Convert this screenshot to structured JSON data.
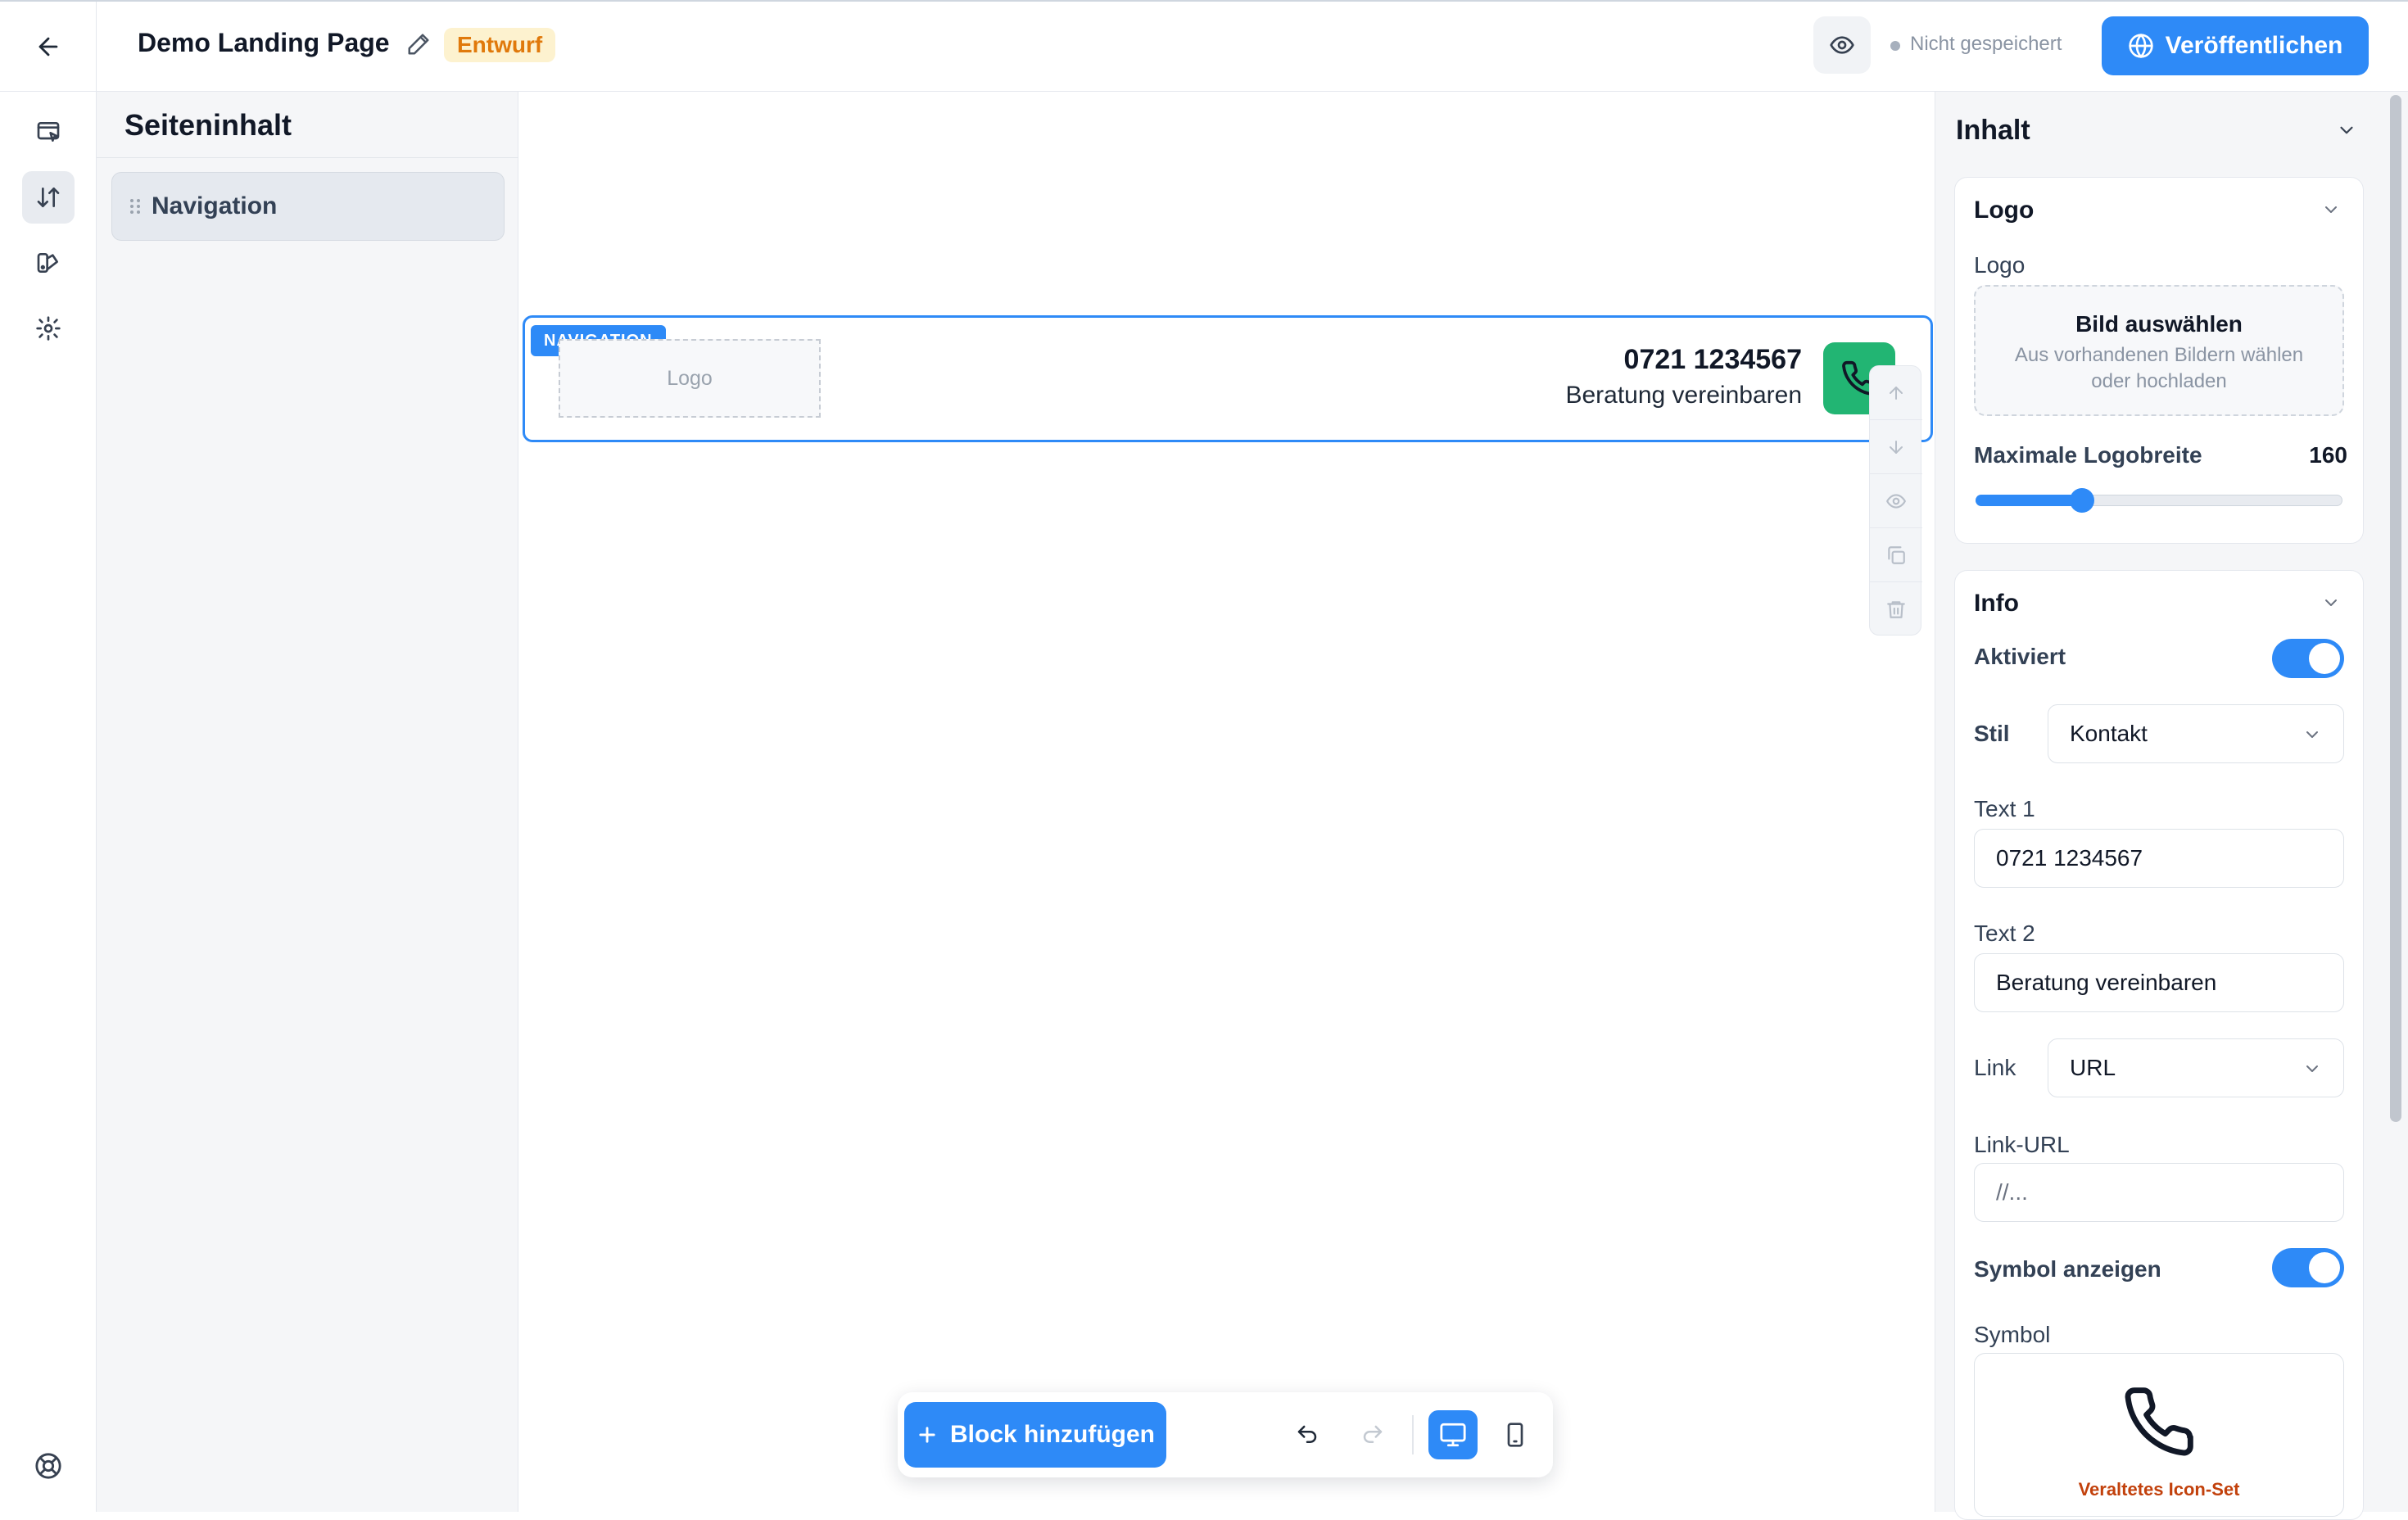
{
  "header": {
    "title": "Demo Landing Page",
    "status_badge": "Entwurf",
    "save_status": "Nicht gespeichert",
    "publish_label": "Veröffentlichen"
  },
  "content_panel": {
    "title": "Seiteninhalt",
    "items": [
      {
        "label": "Navigation"
      }
    ]
  },
  "canvas": {
    "block_tag": "NAVIGATION",
    "logo_placeholder": "Logo",
    "phone_number": "0721 1234567",
    "phone_subtitle": "Beratung vereinbaren"
  },
  "toolbar": {
    "add_block_label": "Block hinzufügen"
  },
  "settings": {
    "section_title": "Inhalt",
    "logo_card": {
      "title": "Logo",
      "field_label": "Logo",
      "select_image_title": "Bild auswählen",
      "select_image_sub": "Aus vorhandenen Bildern wählen oder hochladen",
      "max_width_label": "Maximale Logobreite",
      "max_width_value": "160",
      "max_width_fraction": 0.29
    },
    "info_card": {
      "title": "Info",
      "enabled_label": "Aktiviert",
      "enabled": true,
      "style_label": "Stil",
      "style_value": "Kontakt",
      "text1_label": "Text 1",
      "text1_value": "0721 1234567",
      "text2_label": "Text 2",
      "text2_value": "Beratung vereinbaren",
      "link_label": "Link",
      "link_value": "URL",
      "link_url_label": "Link-URL",
      "link_url_placeholder": "//...",
      "show_symbol_label": "Symbol anzeigen",
      "show_symbol": true,
      "symbol_label": "Symbol",
      "symbol_note": "Veraltetes Icon-Set"
    }
  },
  "colors": {
    "accent": "#2e8af7",
    "phone_badge": "#22b573",
    "draft_badge_bg": "#fdf2cf",
    "draft_badge_text": "#e0790b"
  }
}
